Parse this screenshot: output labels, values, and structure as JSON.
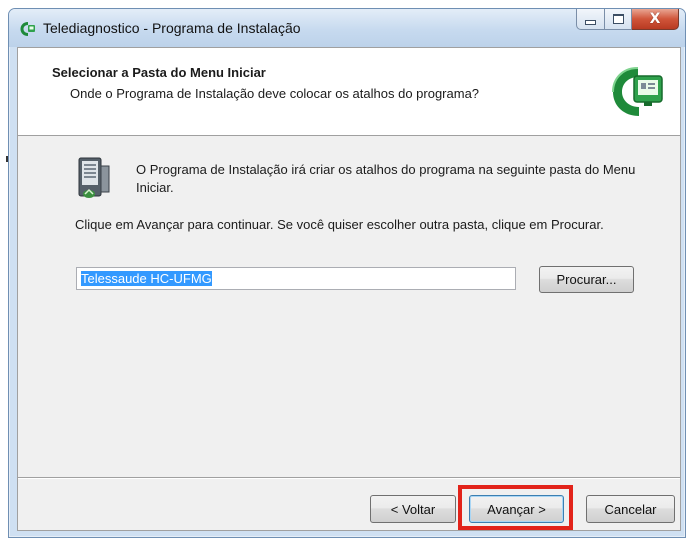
{
  "window": {
    "title": "Telediagnostico - Programa de Instalação",
    "caption_icons": [
      "minimize-icon",
      "maximize-icon",
      "close-icon"
    ],
    "close_glyph": "X"
  },
  "header": {
    "title": "Selecionar a Pasta do Menu Iniciar",
    "subtitle": "Onde o Programa de Instalação deve colocar os atalhos do programa?"
  },
  "body": {
    "info": "O Programa de Instalação irá criar os atalhos do programa na seguinte pasta do Menu Iniciar.",
    "instruction": "Clique em Avançar para continuar. Se você quiser escolher outra pasta, clique em Procurar.",
    "folder_value": "Telessaude HC-UFMG",
    "browse_label": "Procurar..."
  },
  "footer": {
    "back_label": "< Voltar",
    "next_label": "Avançar >",
    "cancel_label": "Cancelar"
  },
  "colors": {
    "highlight": "#e2231a",
    "selection": "#3399ff",
    "brand_green": "#1f8a3a"
  },
  "icons": {
    "app": "telediagnostico-logo-icon",
    "header": "telediagnostico-logo-icon",
    "folder": "start-menu-folder-icon"
  }
}
